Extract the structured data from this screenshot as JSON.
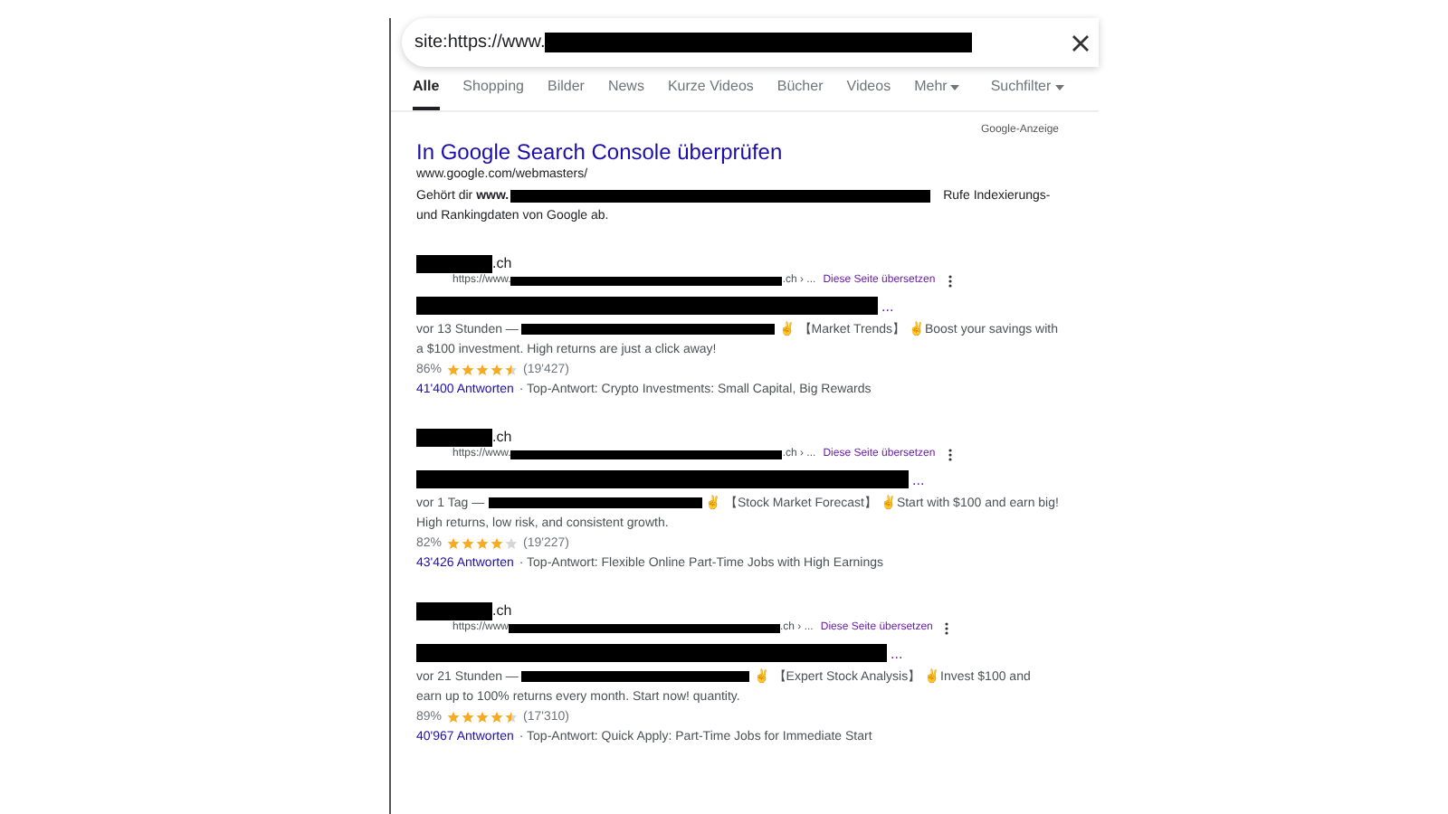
{
  "search": {
    "value": "site:https://www."
  },
  "tabs": [
    {
      "label": "Alle",
      "selected": true
    },
    {
      "label": "Shopping",
      "selected": false
    },
    {
      "label": "Bilder",
      "selected": false
    },
    {
      "label": "News",
      "selected": false
    },
    {
      "label": "Kurze Videos",
      "selected": false
    },
    {
      "label": "Bücher",
      "selected": false
    },
    {
      "label": "Videos",
      "selected": false
    },
    {
      "label": "Mehr",
      "selected": false,
      "kind": "menu"
    }
  ],
  "filter": "Suchfilter",
  "ad": {
    "badge": "Google-Anzeige",
    "title": "In Google Search Console überprüfen",
    "url": "www.google.com/webmasters/",
    "text_before": "Gehört dir **www.**",
    "text_after": "Rufe Indexierungs-",
    "text_line2": "und Rankingdaten von Google ab."
  },
  "results": [
    {
      "site": ".ch",
      "url_prefix": "https://www.",
      "url_suffix": ".ch › ...",
      "translate": "Diese Seite übersetzen",
      "title_more": "...",
      "date": "vor 13 Stunden —",
      "snippet": "✌ 【Market Trends】 ✌Boost your savings with a $100 investment. High returns are just a click away!",
      "rating": "86%",
      "stars": 4.5,
      "count": "(19'427)",
      "answers": "41'400 Antworten",
      "top_answer": "· Top-Antwort: Crypto Investments: Small Capital, Big Rewards"
    },
    {
      "site": ".ch",
      "url_prefix": "https://www.",
      "url_suffix": ".ch › ...",
      "translate": "Diese Seite übersetzen",
      "title_more": "...",
      "date": "vor 1 Tag —",
      "snippet": "✌ 【Stock Market Forecast】 ✌Start with $100 and earn big! High returns, low risk, and consistent growth.",
      "rating": "82%",
      "stars": 4,
      "count": "(19'227)",
      "answers": "43'426 Antworten",
      "top_answer": "· Top-Antwort: Flexible Online Part-Time Jobs with High Earnings"
    },
    {
      "site": ".ch",
      "url_prefix": "https://www",
      "url_suffix": ".ch › ...",
      "translate": "Diese Seite übersetzen",
      "title_more": "...",
      "date": "vor 21 Stunden —",
      "snippet": "✌ 【Expert Stock Analysis】 ✌Invest $100 and earn up to 100% returns every month. Start now! quantity.",
      "rating": "89%",
      "stars": 4.5,
      "count": "(17'310)",
      "answers": "40'967 Antworten",
      "top_answer": "· Top-Antwort: Quick Apply: Part-Time Jobs for Immediate Start"
    }
  ]
}
